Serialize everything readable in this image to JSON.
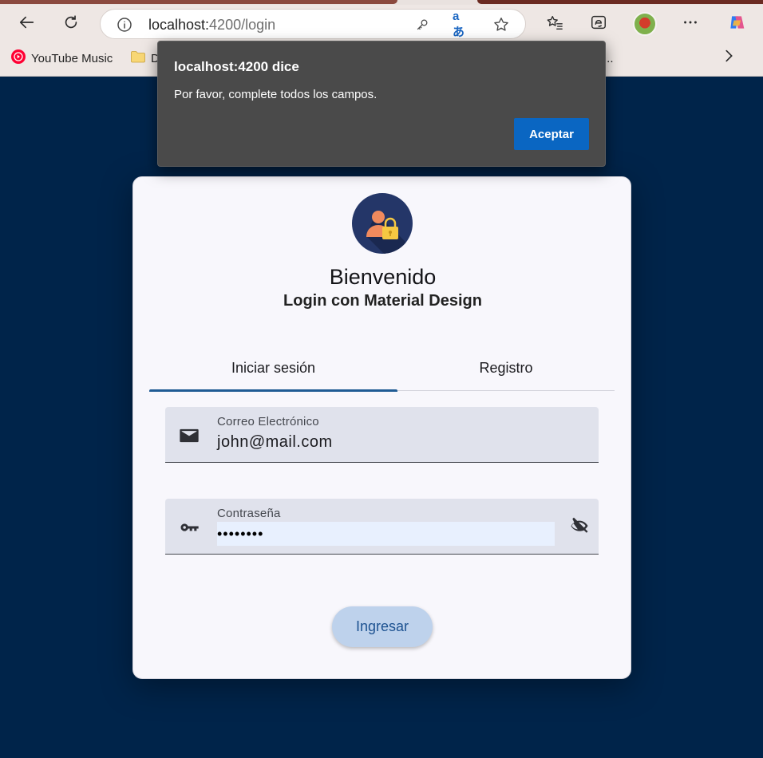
{
  "browser": {
    "url_host": "localhost:",
    "url_rest": "4200/login",
    "bookmarks": [
      {
        "label": "YouTube Music"
      },
      {
        "label": "D"
      }
    ],
    "overflow_text": "..."
  },
  "dialog": {
    "title": "localhost:4200 dice",
    "message": "Por favor, complete todos los campos.",
    "ok_label": "Aceptar"
  },
  "login": {
    "title": "Bienvenido",
    "subtitle": "Login con Material Design",
    "tabs": [
      {
        "label": "Iniciar sesión",
        "active": true
      },
      {
        "label": "Registro",
        "active": false
      }
    ],
    "email": {
      "label": "Correo Electrónico",
      "value": "john@mail.com"
    },
    "password": {
      "label": "Contraseña",
      "value": "••••••••"
    },
    "submit_label": "Ingresar"
  },
  "colors": {
    "page_bg": "#00244a",
    "card_bg": "#f8f7fc",
    "primary": "#1f5b94",
    "field_bg": "#e0e2ec",
    "dialog_bg": "#4a4a4a",
    "dialog_button": "#0a66c2"
  }
}
